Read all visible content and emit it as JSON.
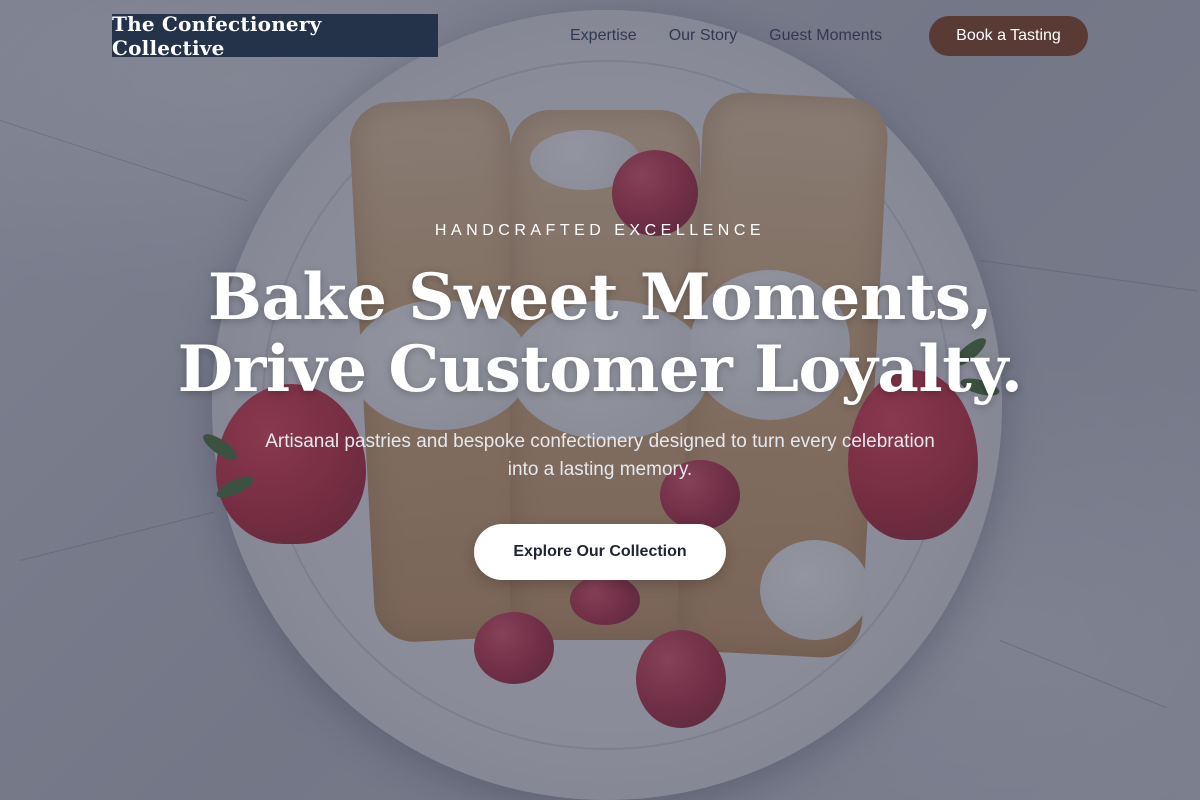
{
  "brand": {
    "name": "The Confectionery Collective"
  },
  "nav": {
    "items": [
      {
        "label": "Expertise"
      },
      {
        "label": "Our Story"
      },
      {
        "label": "Guest Moments"
      }
    ],
    "cta_label": "Book a Tasting"
  },
  "hero": {
    "eyebrow": "HANDCRAFTED EXCELLENCE",
    "headline_line1": "Bake Sweet Moments,",
    "headline_line2": "Drive Customer Loyalty.",
    "subtext": "Artisanal pastries and bespoke confectionery designed to turn every celebration into a lasting memory.",
    "cta_label": "Explore Our Collection",
    "background_image": "crepes-with-berries-and-cream-on-white-plate"
  },
  "colors": {
    "brand_bg": "#25334a",
    "nav_text": "#2f3a52",
    "cta_top_bg": "#5a3a34",
    "overlay": "#3a3e54",
    "cta_main_bg": "#ffffff",
    "cta_main_text": "#1f2535"
  }
}
